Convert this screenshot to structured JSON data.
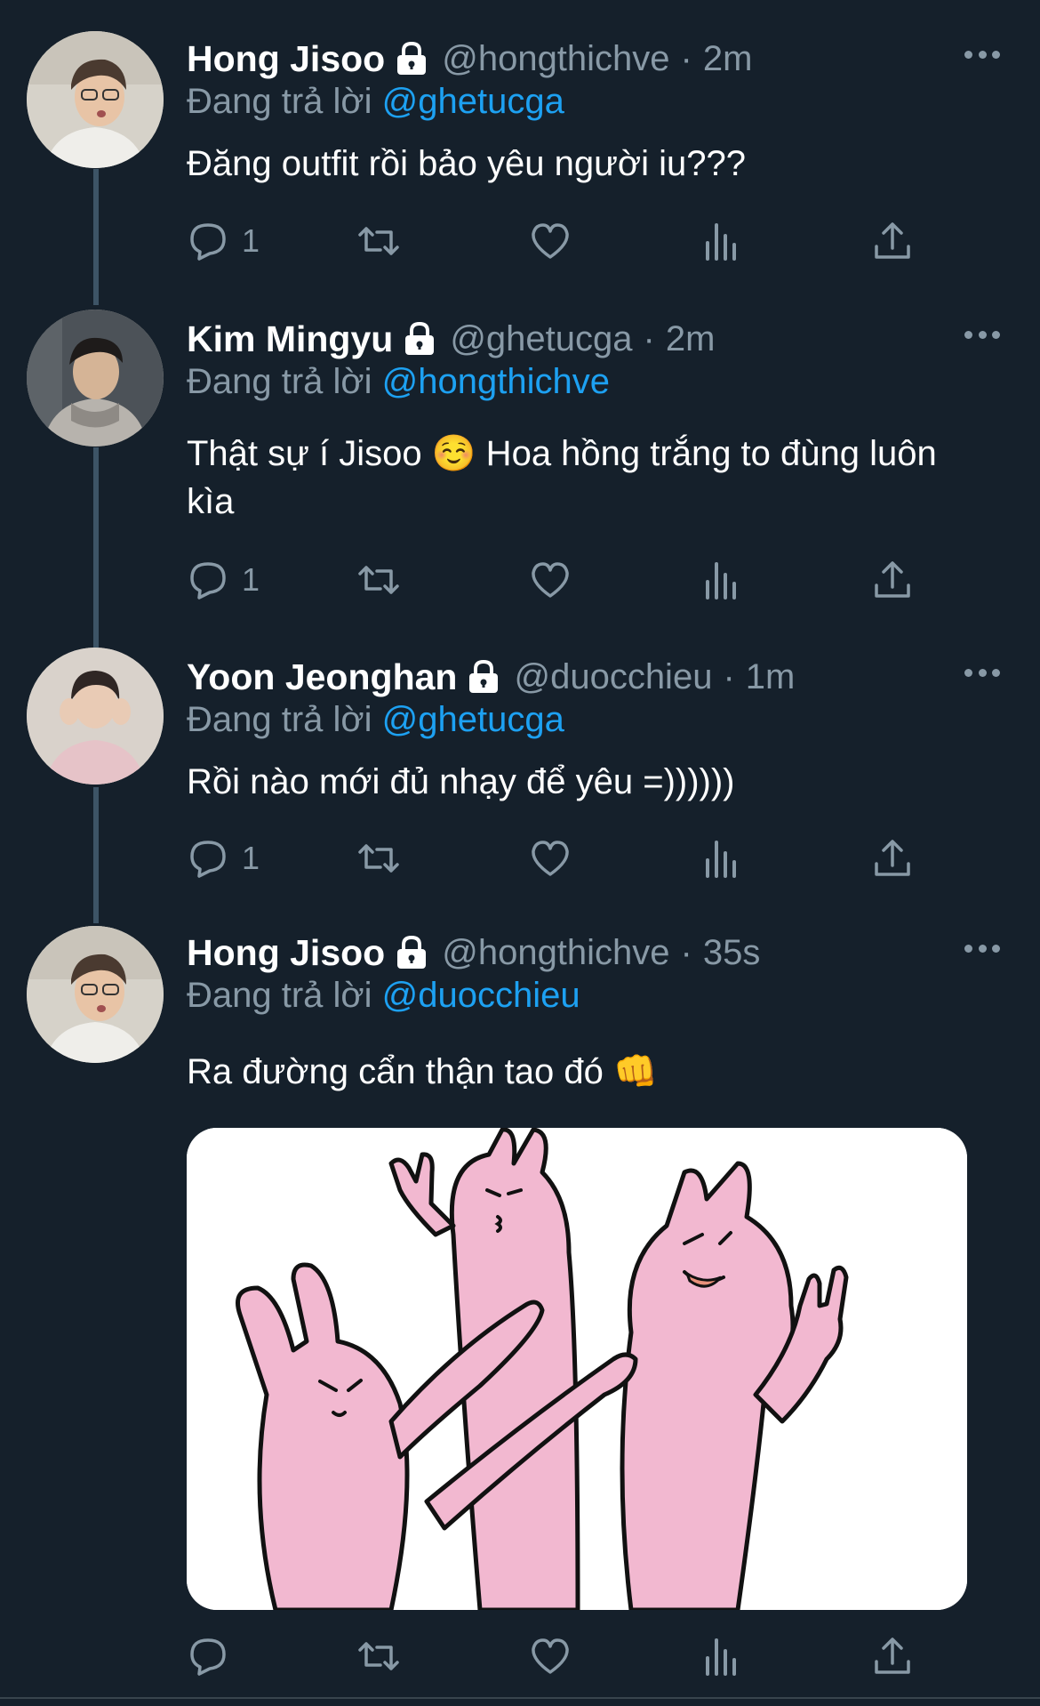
{
  "tweets": [
    {
      "name": "Hong Jisoo",
      "handle": "@hongthichve",
      "time": "2m",
      "reply_prefix": "Đang trả lời ",
      "reply_to": "@ghetucga",
      "text": "Đăng outfit rồi bảo yêu người iu???",
      "reply_count": "1",
      "avatar": "avatar-hong-jisoo"
    },
    {
      "name": "Kim Mingyu",
      "handle": "@ghetucga",
      "time": "2m",
      "reply_prefix": "Đang trả lời ",
      "reply_to": "@hongthichve",
      "text": "Thật sự í Jisoo ☺️  Hoa hồng trắng to đùng luôn kìa",
      "reply_count": "1",
      "avatar": "avatar-kim-mingyu"
    },
    {
      "name": "Yoon Jeonghan",
      "handle": "@duocchieu",
      "time": "1m",
      "reply_prefix": "Đang trả lời ",
      "reply_to": "@ghetucga",
      "text": "Rồi nào mới đủ nhạy để yêu =))))))",
      "reply_count": "1",
      "avatar": "avatar-yoon-jeonghan"
    },
    {
      "name": "Hong Jisoo",
      "handle": "@hongthichve",
      "time": "35s",
      "reply_prefix": "Đang trả lời ",
      "reply_to": "@duocchieu",
      "text": "Ra đường cẩn thận tao đó 👊",
      "reply_count": "",
      "avatar": "avatar-hong-jisoo",
      "media": "pink-rabbits-sticker"
    }
  ],
  "separator": "·",
  "icons": {
    "lock": "lock-icon",
    "more": "more-icon",
    "reply": "reply-icon",
    "retweet": "retweet-icon",
    "like": "heart-icon",
    "analytics": "analytics-icon",
    "share": "share-icon"
  },
  "colors": {
    "background": "#15202b",
    "secondary_text": "#8899a6",
    "mention": "#1da1f2",
    "thread_line": "#3d5466",
    "rabbit_pink": "#f2b8d0"
  }
}
